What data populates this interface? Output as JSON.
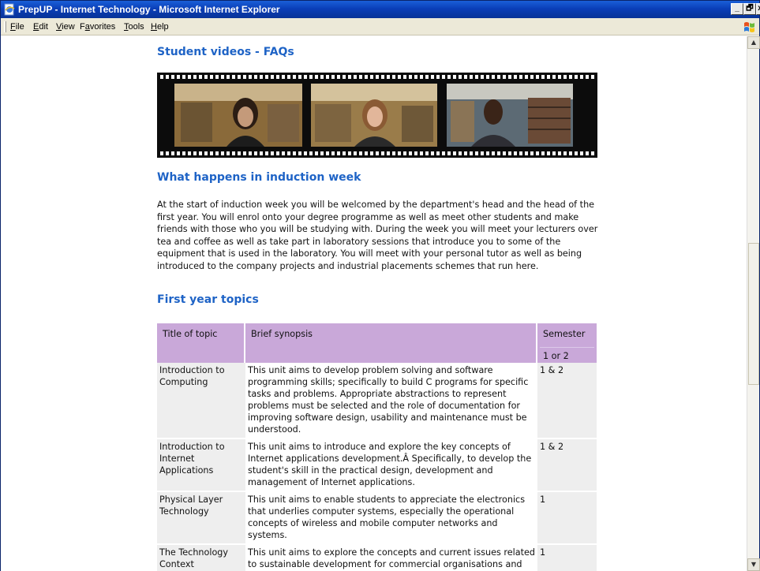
{
  "window": {
    "title": "PrepUP - Internet Technology - Microsoft Internet Explorer",
    "controls": {
      "minimize": "_",
      "maximize": "🗗",
      "close": "x"
    }
  },
  "menu": [
    {
      "label": "File"
    },
    {
      "label": "Edit"
    },
    {
      "label": "View"
    },
    {
      "label": "Favorites"
    },
    {
      "label": "Tools"
    },
    {
      "label": "Help"
    }
  ],
  "page": {
    "videos_heading": "Student videos - FAQs",
    "induction_heading": "What happens in induction week",
    "induction_text": "At the start of induction week you will be welcomed by the department's head and the head of the first year. You will enrol onto your degree programme as well as meet other students and make friends with those who you will be studying with. During the week you will meet your lecturers over tea and coffee as well as take part in laboratory sessions that introduce you to some of the equipment that is used in the laboratory. You will meet with your personal tutor as well as being introduced to the company projects and industrial placements schemes that run here.",
    "topics_heading": "First year topics",
    "table": {
      "headers": [
        "Title of topic",
        "Brief synopsis",
        "Semester",
        "1 or 2"
      ],
      "rows": [
        {
          "title": "Introduction to Computing",
          "synopsis": "This unit aims to develop problem solving and software programming skills; specifically to build C programs for specific tasks and problems. Appropriate abstractions to represent problems must be selected and the role of documentation for improving software design, usability and maintenance must be understood.",
          "semester": "1 & 2"
        },
        {
          "title": "Introduction to Internet Applications",
          "synopsis": "This unit aims to introduce and explore the key concepts of Internet applications development.Â Specifically, to develop the student's skill in the practical design, development and management of Internet applications.",
          "semester": "1 & 2"
        },
        {
          "title": "Physical Layer Technology",
          "synopsis": "This unit aims to enable students to appreciate the electronics that underlies computer systems, especially the operational concepts of wireless and mobile computer networks and systems.",
          "semester": "1"
        },
        {
          "title": "The Technology Context",
          "synopsis": "This unit aims to explore the concepts and current issues related to sustainable development for commercial organisations and activities.",
          "semester": "1"
        }
      ]
    }
  },
  "colors": {
    "titlebar": "#0a3fb8",
    "heading_blue": "#1e63c6",
    "table_header": "#c9a8d9",
    "table_cell_grey": "#eeeeee"
  },
  "icons": {
    "app": "ie-page-icon",
    "logo": "windows-flag-icon"
  }
}
